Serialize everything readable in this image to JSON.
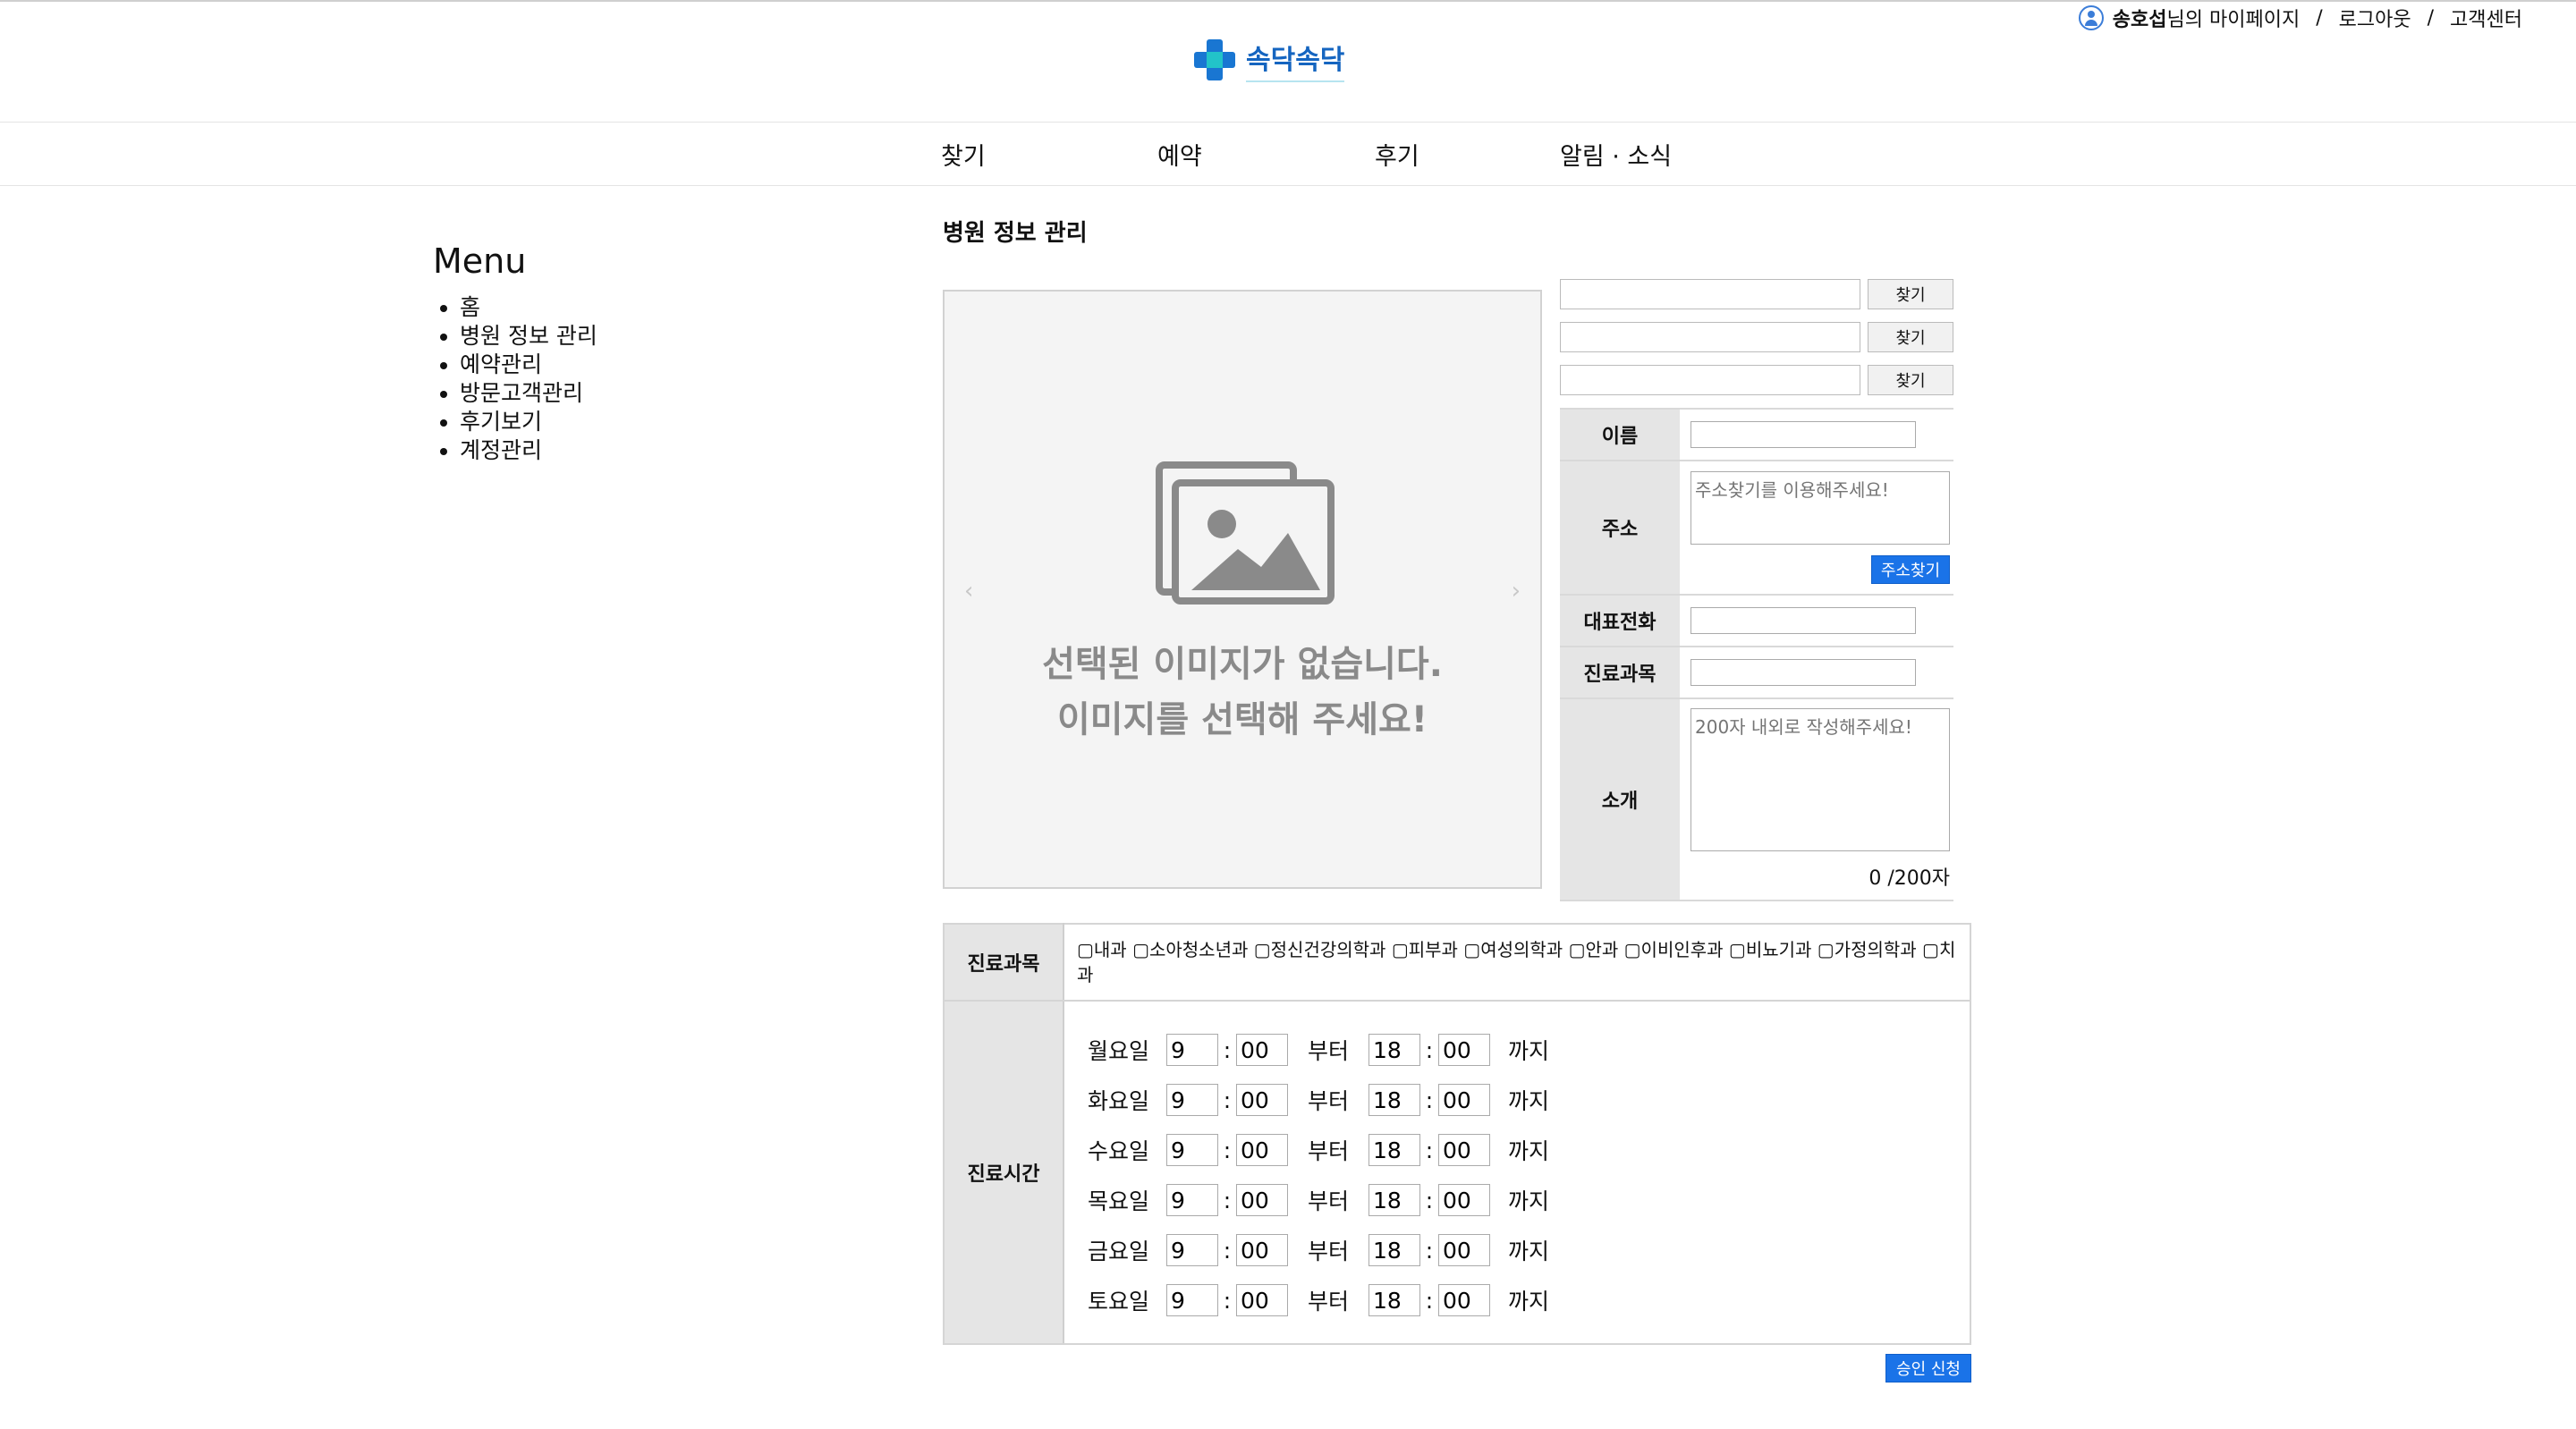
{
  "topbar": {
    "user_name": "송호섭",
    "mypage_label": "님의 마이페이지",
    "separator": "/",
    "logout_label": "로그아웃",
    "support_label": "고객센터"
  },
  "logo": {
    "text": "속닥속닥",
    "colors": {
      "cross": "#1976d2",
      "center": "#22c3c9"
    }
  },
  "nav": {
    "items": [
      "찾기",
      "예약",
      "후기",
      "알림 · 소식"
    ]
  },
  "sidebar": {
    "title": "Menu",
    "items": [
      "홈",
      "병원 정보 관리",
      "예약관리",
      "방문고객관리",
      "후기보기",
      "계정관리"
    ]
  },
  "content": {
    "title": "병원 정보 관리"
  },
  "image_slider": {
    "prev_glyph": "‹",
    "next_glyph": "›",
    "message_line1": "선택된 이미지가 없습니다.",
    "message_line2": "이미지를 선택해 주세요!"
  },
  "file_finders": [
    {
      "value": "",
      "button_label": "찾기"
    },
    {
      "value": "",
      "button_label": "찾기"
    },
    {
      "value": "",
      "button_label": "찾기"
    }
  ],
  "info_form": {
    "name_label": "이름",
    "name_value": "",
    "address_label": "주소",
    "address_placeholder": "주소찾기를 이용해주세요!",
    "address_button": "주소찾기",
    "phone_label": "대표전화",
    "phone_value": "",
    "dept_label": "진료과목",
    "dept_value": "",
    "intro_label": "소개",
    "intro_placeholder": "200자 내외로 작성해주세요!",
    "char_counter": "0 /200자"
  },
  "schedule": {
    "dept_label": "진료과목",
    "departments": [
      "내과",
      "소아청소년과",
      "정신건강의학과",
      "피부과",
      "여성의학과",
      "안과",
      "이비인후과",
      "비뇨기과",
      "가정의학과",
      "치과"
    ],
    "hours_label": "진료시간",
    "from_label": "부터",
    "until_label": "까지",
    "colon": ":",
    "days": [
      {
        "day": "월요일",
        "start_h": "9",
        "start_m": "00",
        "end_h": "18",
        "end_m": "00"
      },
      {
        "day": "화요일",
        "start_h": "9",
        "start_m": "00",
        "end_h": "18",
        "end_m": "00"
      },
      {
        "day": "수요일",
        "start_h": "9",
        "start_m": "00",
        "end_h": "18",
        "end_m": "00"
      },
      {
        "day": "목요일",
        "start_h": "9",
        "start_m": "00",
        "end_h": "18",
        "end_m": "00"
      },
      {
        "day": "금요일",
        "start_h": "9",
        "start_m": "00",
        "end_h": "18",
        "end_m": "00"
      },
      {
        "day": "토요일",
        "start_h": "9",
        "start_m": "00",
        "end_h": "18",
        "end_m": "00"
      }
    ]
  },
  "submit_label": "승인 신청",
  "colors": {
    "primary_button": "#1a73e8",
    "header_cell": "#e5e5e5"
  }
}
